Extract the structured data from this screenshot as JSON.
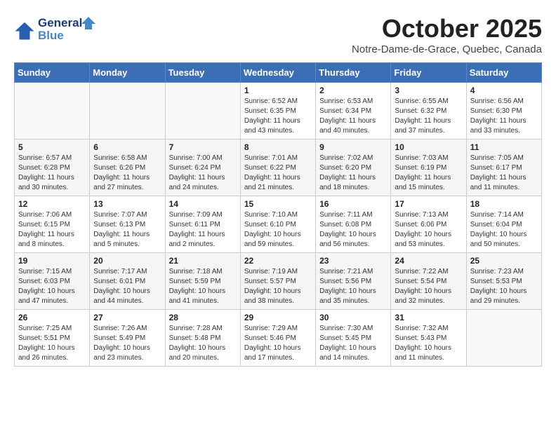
{
  "header": {
    "logo_line1": "General",
    "logo_line2": "Blue",
    "title": "October 2025",
    "subtitle": "Notre-Dame-de-Grace, Quebec, Canada"
  },
  "weekdays": [
    "Sunday",
    "Monday",
    "Tuesday",
    "Wednesday",
    "Thursday",
    "Friday",
    "Saturday"
  ],
  "weeks": [
    [
      {
        "day": "",
        "info": ""
      },
      {
        "day": "",
        "info": ""
      },
      {
        "day": "",
        "info": ""
      },
      {
        "day": "1",
        "info": "Sunrise: 6:52 AM\nSunset: 6:35 PM\nDaylight: 11 hours\nand 43 minutes."
      },
      {
        "day": "2",
        "info": "Sunrise: 6:53 AM\nSunset: 6:34 PM\nDaylight: 11 hours\nand 40 minutes."
      },
      {
        "day": "3",
        "info": "Sunrise: 6:55 AM\nSunset: 6:32 PM\nDaylight: 11 hours\nand 37 minutes."
      },
      {
        "day": "4",
        "info": "Sunrise: 6:56 AM\nSunset: 6:30 PM\nDaylight: 11 hours\nand 33 minutes."
      }
    ],
    [
      {
        "day": "5",
        "info": "Sunrise: 6:57 AM\nSunset: 6:28 PM\nDaylight: 11 hours\nand 30 minutes."
      },
      {
        "day": "6",
        "info": "Sunrise: 6:58 AM\nSunset: 6:26 PM\nDaylight: 11 hours\nand 27 minutes."
      },
      {
        "day": "7",
        "info": "Sunrise: 7:00 AM\nSunset: 6:24 PM\nDaylight: 11 hours\nand 24 minutes."
      },
      {
        "day": "8",
        "info": "Sunrise: 7:01 AM\nSunset: 6:22 PM\nDaylight: 11 hours\nand 21 minutes."
      },
      {
        "day": "9",
        "info": "Sunrise: 7:02 AM\nSunset: 6:20 PM\nDaylight: 11 hours\nand 18 minutes."
      },
      {
        "day": "10",
        "info": "Sunrise: 7:03 AM\nSunset: 6:19 PM\nDaylight: 11 hours\nand 15 minutes."
      },
      {
        "day": "11",
        "info": "Sunrise: 7:05 AM\nSunset: 6:17 PM\nDaylight: 11 hours\nand 11 minutes."
      }
    ],
    [
      {
        "day": "12",
        "info": "Sunrise: 7:06 AM\nSunset: 6:15 PM\nDaylight: 11 hours\nand 8 minutes."
      },
      {
        "day": "13",
        "info": "Sunrise: 7:07 AM\nSunset: 6:13 PM\nDaylight: 11 hours\nand 5 minutes."
      },
      {
        "day": "14",
        "info": "Sunrise: 7:09 AM\nSunset: 6:11 PM\nDaylight: 11 hours\nand 2 minutes."
      },
      {
        "day": "15",
        "info": "Sunrise: 7:10 AM\nSunset: 6:10 PM\nDaylight: 10 hours\nand 59 minutes."
      },
      {
        "day": "16",
        "info": "Sunrise: 7:11 AM\nSunset: 6:08 PM\nDaylight: 10 hours\nand 56 minutes."
      },
      {
        "day": "17",
        "info": "Sunrise: 7:13 AM\nSunset: 6:06 PM\nDaylight: 10 hours\nand 53 minutes."
      },
      {
        "day": "18",
        "info": "Sunrise: 7:14 AM\nSunset: 6:04 PM\nDaylight: 10 hours\nand 50 minutes."
      }
    ],
    [
      {
        "day": "19",
        "info": "Sunrise: 7:15 AM\nSunset: 6:03 PM\nDaylight: 10 hours\nand 47 minutes."
      },
      {
        "day": "20",
        "info": "Sunrise: 7:17 AM\nSunset: 6:01 PM\nDaylight: 10 hours\nand 44 minutes."
      },
      {
        "day": "21",
        "info": "Sunrise: 7:18 AM\nSunset: 5:59 PM\nDaylight: 10 hours\nand 41 minutes."
      },
      {
        "day": "22",
        "info": "Sunrise: 7:19 AM\nSunset: 5:57 PM\nDaylight: 10 hours\nand 38 minutes."
      },
      {
        "day": "23",
        "info": "Sunrise: 7:21 AM\nSunset: 5:56 PM\nDaylight: 10 hours\nand 35 minutes."
      },
      {
        "day": "24",
        "info": "Sunrise: 7:22 AM\nSunset: 5:54 PM\nDaylight: 10 hours\nand 32 minutes."
      },
      {
        "day": "25",
        "info": "Sunrise: 7:23 AM\nSunset: 5:53 PM\nDaylight: 10 hours\nand 29 minutes."
      }
    ],
    [
      {
        "day": "26",
        "info": "Sunrise: 7:25 AM\nSunset: 5:51 PM\nDaylight: 10 hours\nand 26 minutes."
      },
      {
        "day": "27",
        "info": "Sunrise: 7:26 AM\nSunset: 5:49 PM\nDaylight: 10 hours\nand 23 minutes."
      },
      {
        "day": "28",
        "info": "Sunrise: 7:28 AM\nSunset: 5:48 PM\nDaylight: 10 hours\nand 20 minutes."
      },
      {
        "day": "29",
        "info": "Sunrise: 7:29 AM\nSunset: 5:46 PM\nDaylight: 10 hours\nand 17 minutes."
      },
      {
        "day": "30",
        "info": "Sunrise: 7:30 AM\nSunset: 5:45 PM\nDaylight: 10 hours\nand 14 minutes."
      },
      {
        "day": "31",
        "info": "Sunrise: 7:32 AM\nSunset: 5:43 PM\nDaylight: 10 hours\nand 11 minutes."
      },
      {
        "day": "",
        "info": ""
      }
    ]
  ]
}
